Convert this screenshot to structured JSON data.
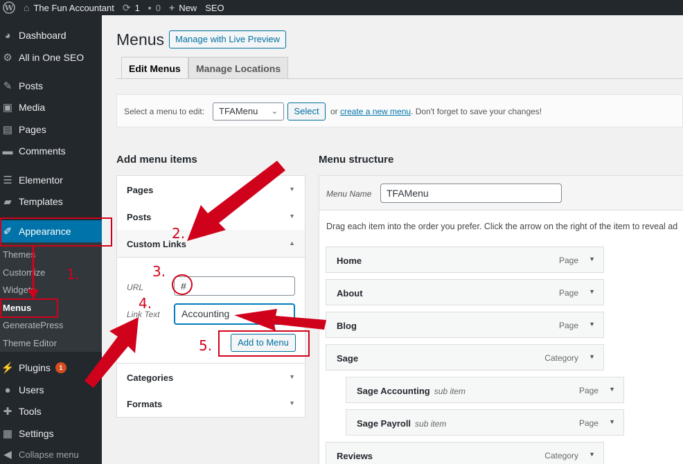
{
  "admin_bar": {
    "site_name": "The Fun Accountant",
    "updates": "1",
    "comments": "0",
    "new_label": "New",
    "seo_label": "SEO"
  },
  "sidebar": {
    "items": [
      {
        "label": "Dashboard",
        "icon": "dashboard-icon"
      },
      {
        "label": "All in One SEO",
        "icon": "gear-icon"
      },
      {
        "label": "Posts",
        "icon": "pin-icon"
      },
      {
        "label": "Media",
        "icon": "media-icon"
      },
      {
        "label": "Pages",
        "icon": "pages-icon"
      },
      {
        "label": "Comments",
        "icon": "comment-icon"
      },
      {
        "label": "Elementor",
        "icon": "elementor-icon"
      },
      {
        "label": "Templates",
        "icon": "folder-icon"
      },
      {
        "label": "Appearance",
        "icon": "brush-icon"
      }
    ],
    "submenu": [
      "Themes",
      "Customize",
      "Widgets",
      "Menus",
      "GeneratePress",
      "Theme Editor"
    ],
    "lower_items": [
      {
        "label": "Plugins",
        "icon": "plugin-icon",
        "badge": "1"
      },
      {
        "label": "Users",
        "icon": "user-icon"
      },
      {
        "label": "Tools",
        "icon": "wrench-icon"
      },
      {
        "label": "Settings",
        "icon": "settings-icon"
      }
    ],
    "collapse": "Collapse menu"
  },
  "header": {
    "title": "Menus",
    "live_preview": "Manage with Live Preview",
    "tabs": [
      "Edit Menus",
      "Manage Locations"
    ]
  },
  "select_bar": {
    "label": "Select a menu to edit:",
    "selected": "TFAMenu",
    "button": "Select",
    "or": "or",
    "create_link": "create a new menu",
    "suffix": ". Don't forget to save your changes!"
  },
  "add_items": {
    "heading": "Add menu items",
    "sections": [
      "Pages",
      "Posts",
      "Custom Links",
      "Categories",
      "Formats"
    ],
    "url_label": "URL",
    "url_value": "#",
    "link_text_label": "Link Text",
    "link_text_value": "Accounting",
    "add_button": "Add to Menu"
  },
  "structure": {
    "heading": "Menu structure",
    "name_label": "Menu Name",
    "name_value": "TFAMenu",
    "drag_note": "Drag each item into the order you prefer. Click the arrow on the right of the item to reveal ad",
    "items": [
      {
        "title": "Home",
        "type": "Page",
        "sub": ""
      },
      {
        "title": "About",
        "type": "Page",
        "sub": ""
      },
      {
        "title": "Blog",
        "type": "Page",
        "sub": ""
      },
      {
        "title": "Sage",
        "type": "Category",
        "sub": ""
      },
      {
        "title": "Sage Accounting",
        "type": "Page",
        "sub": "sub item"
      },
      {
        "title": "Sage Payroll",
        "type": "Page",
        "sub": "sub item"
      },
      {
        "title": "Reviews",
        "type": "Category",
        "sub": ""
      }
    ]
  },
  "annotations": {
    "step1": "1.",
    "step2": "2.",
    "step3": "3.",
    "step4": "4.",
    "step5": "5.",
    "color": "#d0021b"
  },
  "colors": {
    "admin_bg": "#23282d",
    "accent": "#0073aa",
    "badge": "#d54e21"
  }
}
